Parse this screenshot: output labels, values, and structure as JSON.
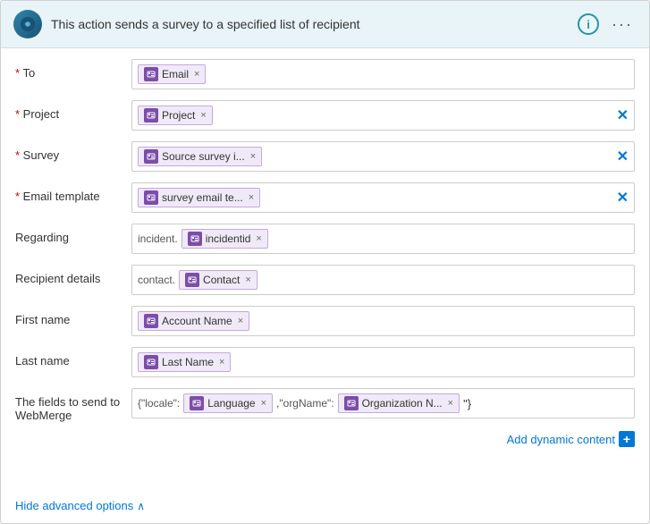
{
  "header": {
    "title": "This action sends a survey to a specified list of recipient",
    "info_label": "i",
    "more_label": "···"
  },
  "fields": [
    {
      "id": "to",
      "label": "* To",
      "required": true,
      "tags": [
        {
          "icon": true,
          "text": "Email",
          "closeable": true
        }
      ],
      "has_clear": false,
      "prefix": null
    },
    {
      "id": "project",
      "label": "* Project",
      "required": true,
      "tags": [
        {
          "icon": true,
          "text": "Project",
          "closeable": true
        }
      ],
      "has_clear": true,
      "prefix": null
    },
    {
      "id": "survey",
      "label": "* Survey",
      "required": true,
      "tags": [
        {
          "icon": true,
          "text": "Source survey i...",
          "closeable": true
        }
      ],
      "has_clear": true,
      "prefix": null
    },
    {
      "id": "email-template",
      "label": "* Email template",
      "required": true,
      "tags": [
        {
          "icon": true,
          "text": "survey email te...",
          "closeable": true
        }
      ],
      "has_clear": true,
      "prefix": null
    },
    {
      "id": "regarding",
      "label": "Regarding",
      "required": false,
      "prefix_text": "incident.",
      "tags": [
        {
          "icon": true,
          "text": "incidentid",
          "closeable": true
        }
      ],
      "has_clear": false
    },
    {
      "id": "recipient-details",
      "label": "Recipient details",
      "required": false,
      "prefix_text": "contact.",
      "tags": [
        {
          "icon": true,
          "text": "Contact",
          "closeable": true
        }
      ],
      "has_clear": false
    },
    {
      "id": "first-name",
      "label": "First name",
      "required": false,
      "tags": [
        {
          "icon": true,
          "text": "Account Name",
          "closeable": true
        }
      ],
      "has_clear": false,
      "prefix": null
    },
    {
      "id": "last-name",
      "label": "Last name",
      "required": false,
      "tags": [
        {
          "icon": true,
          "text": "Last Name",
          "closeable": true
        }
      ],
      "has_clear": false,
      "prefix": null
    },
    {
      "id": "webmerge",
      "label": "The fields to send to WebMerge",
      "required": false,
      "prefix_text": "{\"locale\":",
      "tags": [
        {
          "icon": true,
          "text": "Language",
          "closeable": true
        },
        {
          "text_only": " ,\"orgName\":"
        },
        {
          "icon": true,
          "text": "Organization N...",
          "closeable": true
        }
      ],
      "suffix_text": " \"}",
      "has_clear": false
    }
  ],
  "add_dynamic": {
    "label": "Add dynamic content",
    "plus": "+"
  },
  "hide_advanced": {
    "label": "Hide advanced options",
    "icon": "∧"
  }
}
